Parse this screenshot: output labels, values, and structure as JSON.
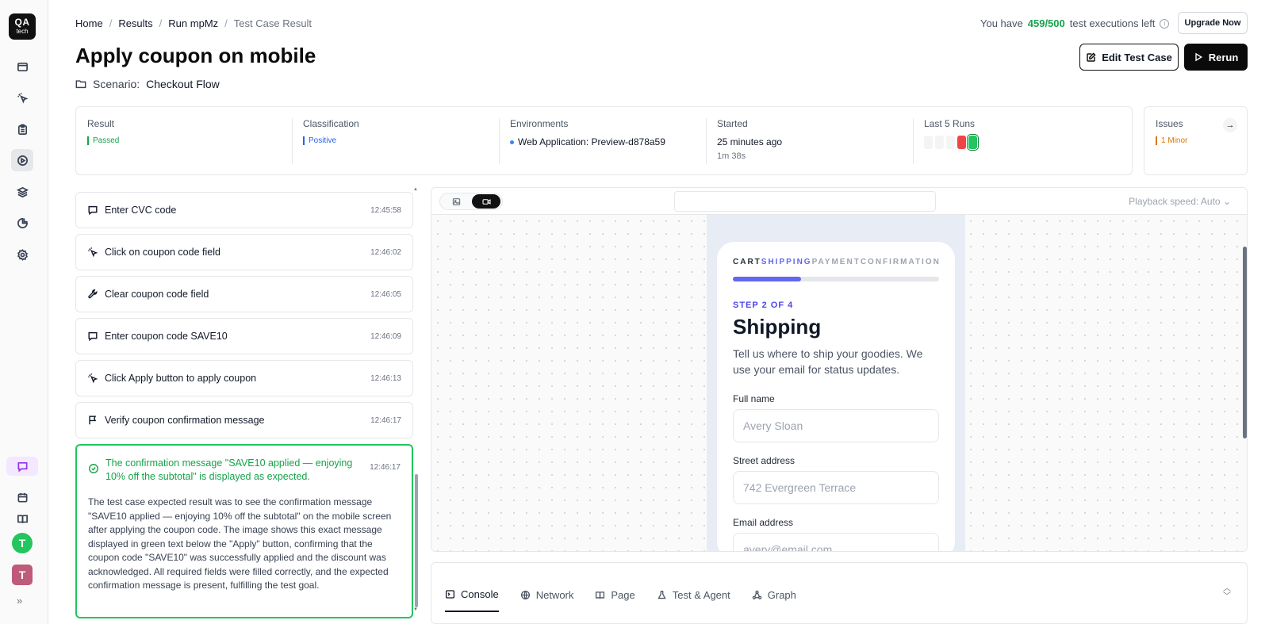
{
  "app": {
    "logo_line1": "QA",
    "logo_line2": "tech"
  },
  "sidebar": {
    "items": [
      {
        "name": "browser-icon"
      },
      {
        "name": "cursor-click-icon"
      },
      {
        "name": "clipboard-icon"
      },
      {
        "name": "play-circle-icon"
      },
      {
        "name": "layers-icon"
      },
      {
        "name": "pie-chart-icon"
      },
      {
        "name": "gear-icon"
      }
    ],
    "bottom_items": [
      {
        "name": "chat-icon"
      },
      {
        "name": "calendar-icon"
      },
      {
        "name": "book-icon"
      }
    ],
    "avatar1": "T",
    "avatar2": "T",
    "expand": "»"
  },
  "breadcrumb": [
    "Home",
    "Results",
    "Run mpMz",
    "Test Case Result"
  ],
  "breadcrumb_sep": "/",
  "quota": {
    "prefix": "You have",
    "count": "459/500",
    "suffix": "test executions left",
    "info": "i"
  },
  "upgrade_label": "Upgrade Now",
  "title": "Apply coupon on mobile",
  "scenario": {
    "label": "Scenario:",
    "name": "Checkout Flow"
  },
  "actions": {
    "edit": "Edit Test Case",
    "rerun": "Rerun"
  },
  "summary": {
    "result": {
      "label": "Result",
      "value": "Passed"
    },
    "classification": {
      "label": "Classification",
      "value": "Positive"
    },
    "environments": {
      "label": "Environments",
      "value": "Web Application: Preview-d878a59"
    },
    "started": {
      "label": "Started",
      "value": "25 minutes ago",
      "duration": "1m 38s"
    },
    "last_runs": {
      "label": "Last 5 Runs",
      "runs": [
        "none",
        "none",
        "none",
        "failed",
        "passed"
      ]
    },
    "issues": {
      "label": "Issues",
      "value": "1 Minor",
      "arrow": "→"
    }
  },
  "steps": [
    {
      "icon": "message-icon",
      "text": "Enter CVC code",
      "time": "12:45:58"
    },
    {
      "icon": "click-icon",
      "text": "Click on coupon code field",
      "time": "12:46:02"
    },
    {
      "icon": "wrench-icon",
      "text": "Clear coupon code field",
      "time": "12:46:05"
    },
    {
      "icon": "message-icon",
      "text": "Enter coupon code SAVE10",
      "time": "12:46:09"
    },
    {
      "icon": "click-icon",
      "text": "Click Apply button to apply coupon",
      "time": "12:46:13"
    },
    {
      "icon": "flag-icon",
      "text": "Verify coupon confirmation message",
      "time": "12:46:17"
    }
  ],
  "result_step": {
    "title": "The confirmation message \"SAVE10 applied — enjoying 10% off the subtotal\" is displayed as expected.",
    "time": "12:46:17",
    "body": "The test case expected result was to see the confirmation message \"SAVE10 applied — enjoying 10% off the subtotal\" on the mobile screen after applying the coupon code. The image shows this exact message displayed in green text below the \"Apply\" button, confirming that the coupon code \"SAVE10\" was successfully applied and the discount was acknowledged. All required fields were filled correctly, and the expected confirmation message is present, fulfilling the test goal."
  },
  "preview": {
    "speed": "Playback speed: Auto",
    "speed_chevron": "⌄",
    "url": "",
    "screen": {
      "crumbs": [
        "CART",
        "SHIPPING",
        "PAYMENT",
        "CONFIRMATION"
      ],
      "progress": 0.33,
      "step_of": "STEP 2 OF 4",
      "title": "Shipping",
      "description": "Tell us where to ship your goodies. We use your email for status updates.",
      "fields": [
        {
          "label": "Full name",
          "placeholder": "Avery Sloan"
        },
        {
          "label": "Street address",
          "placeholder": "742 Evergreen Terrace"
        },
        {
          "label": "Email address",
          "placeholder": "avery@email.com"
        }
      ]
    }
  },
  "tabs": [
    {
      "label": "Console",
      "icon": "terminal-icon",
      "active": true
    },
    {
      "label": "Network",
      "icon": "globe-icon"
    },
    {
      "label": "Page",
      "icon": "book-open-icon"
    },
    {
      "label": "Test & Agent",
      "icon": "flask-icon"
    },
    {
      "label": "Graph",
      "icon": "graph-icon"
    }
  ],
  "colors": {
    "accent": "#6366f1",
    "pass": "#22c55e",
    "fail": "#ef4444",
    "info": "#2563eb",
    "warn": "#d97706"
  }
}
